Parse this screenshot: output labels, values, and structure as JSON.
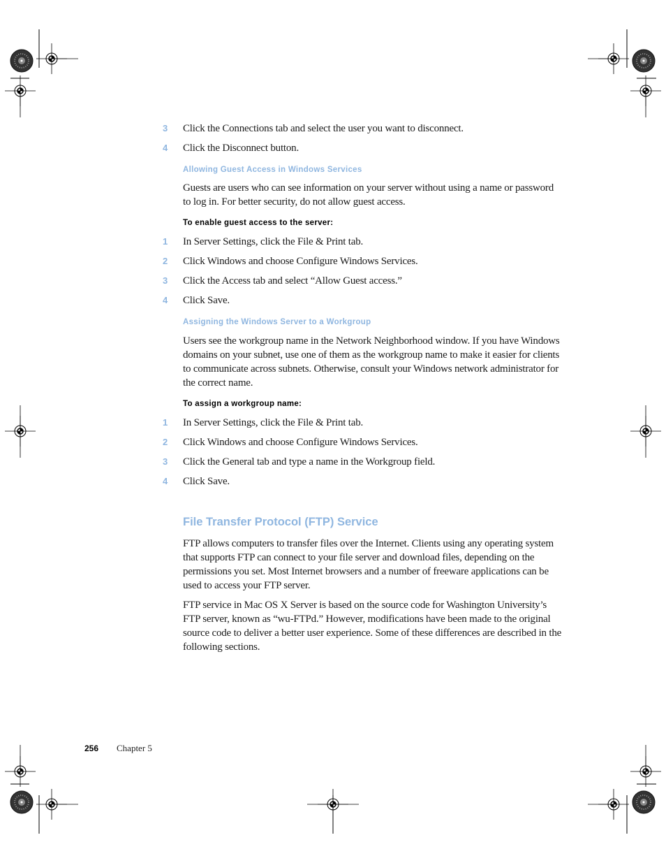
{
  "page": {
    "section1_steps": [
      {
        "num": "3",
        "text": "Click the Connections tab and select the user you want to disconnect."
      },
      {
        "num": "4",
        "text": "Click the Disconnect button."
      }
    ],
    "guest_access": {
      "heading": "Allowing Guest Access in Windows Services",
      "body": "Guests are users who can see information on your server without using a name or password to log in. For better security, do not allow guest access.",
      "task_heading": "To enable guest access to the server:",
      "steps": [
        {
          "num": "1",
          "text": "In Server Settings, click the File & Print tab."
        },
        {
          "num": "2",
          "text": "Click Windows and choose Configure Windows Services."
        },
        {
          "num": "3",
          "text": "Click the Access tab and select “Allow Guest access.”"
        },
        {
          "num": "4",
          "text": "Click Save."
        }
      ]
    },
    "workgroup": {
      "heading": "Assigning the Windows Server to a Workgroup",
      "body": "Users see the workgroup name in the Network Neighborhood window. If you have Windows domains on your subnet, use one of them as the workgroup name to make it easier for clients to communicate across subnets. Otherwise, consult your Windows network administrator for the correct name.",
      "task_heading": "To assign a workgroup name:",
      "steps": [
        {
          "num": "1",
          "text": "In Server Settings, click the File & Print tab."
        },
        {
          "num": "2",
          "text": "Click Windows and choose Configure Windows Services."
        },
        {
          "num": "3",
          "text": "Click the General tab and type a name in the Workgroup field."
        },
        {
          "num": "4",
          "text": "Click Save."
        }
      ]
    },
    "ftp": {
      "heading": "File Transfer Protocol (FTP) Service",
      "para1": "FTP allows computers to transfer files over the Internet. Clients using any operating system that supports FTP can connect to your file server and download files, depending on the permissions you set. Most Internet browsers and a number of freeware applications can be used to access your FTP server.",
      "para2": "FTP service in Mac OS X Server is based on the source code for Washington University’s FTP server, known as “wu-FTPd.” However, modifications have been made to the original source code to deliver a better user experience. Some of these differences are described in the following sections."
    },
    "footer": {
      "page_number": "256",
      "chapter": "Chapter  5"
    },
    "colors": {
      "accent": "#8fb6e0",
      "text": "#1a1a1a"
    }
  }
}
